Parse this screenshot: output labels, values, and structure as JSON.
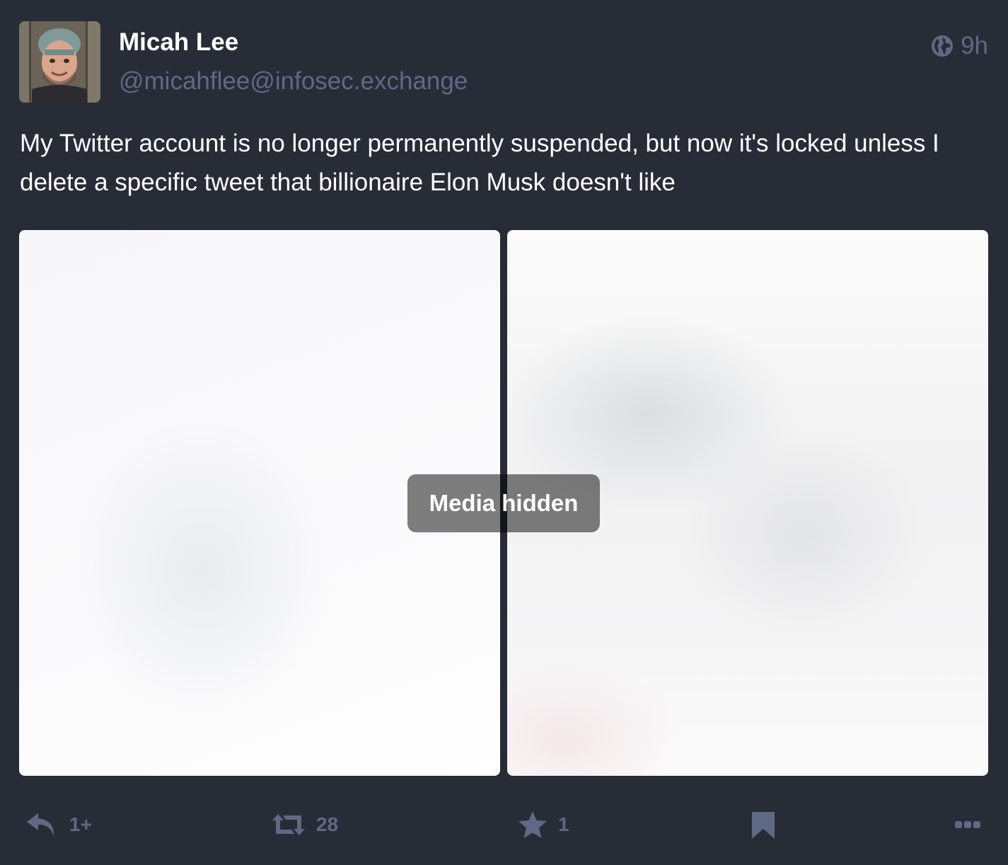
{
  "account": {
    "display_name": "Micah Lee",
    "handle": "@micahflee@infosec.exchange"
  },
  "status": {
    "visibility_icon": "globe-icon",
    "relative_time": "9h",
    "content": "My Twitter account is no longer permanently suspended, but now it's locked unless I delete a specific tweet that billionaire Elon Musk doesn't like"
  },
  "media": {
    "spoiler_label": "Media hidden"
  },
  "actions": {
    "reply_count": "1+",
    "boost_count": "28",
    "favourite_count": "1"
  },
  "icons": {
    "reply": "reply-icon",
    "boost": "boost-icon",
    "favourite": "star-icon",
    "bookmark": "bookmark-icon",
    "more": "more-icon"
  },
  "colors": {
    "background": "#282c37",
    "muted": "#606984",
    "text": "#ffffff"
  }
}
